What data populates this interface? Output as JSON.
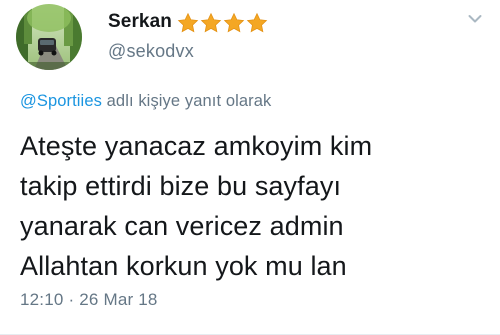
{
  "tweet": {
    "author": {
      "display_name": "Serkan",
      "handle": "@sekodvx",
      "name_emojis": [
        "star",
        "star",
        "star",
        "star"
      ]
    },
    "reply_context": {
      "mention": "@Sportiies",
      "suffix": "adlı kişiye yanıt olarak"
    },
    "text": "Ateşte yanacaz amkoyim kim\ntakip ettirdi bize bu sayfayı\nyanarak can vericez admin\nAllahtan korkun yok mu lan",
    "timestamp": "12:10 · 26 Mar 18",
    "menu_icon": "chevron-down-icon"
  },
  "colors": {
    "text": "#14171a",
    "secondary": "#657786",
    "link": "#1b95e0",
    "star": "#f4a724",
    "divider": "#e6ecf0"
  }
}
